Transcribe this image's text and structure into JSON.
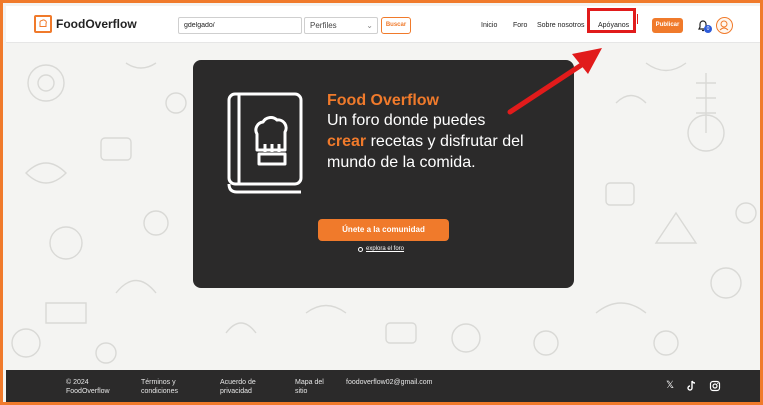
{
  "header": {
    "brand": "FoodOverflow",
    "search": {
      "value": "gdelgado/"
    },
    "filter": {
      "selected": "Perfiles"
    },
    "search_button": "Buscar",
    "nav": [
      "Inicio",
      "Foro",
      "Sobre nosotros",
      "Apóyanos"
    ],
    "publish_button": "Publicar",
    "notification_count": "0"
  },
  "hero": {
    "title": "Food Overflow",
    "line1": "Un foro donde puedes",
    "highlight": "crear",
    "line2": " recetas y disfrutar del mundo de la comida.",
    "join_button": "Únete a la comunidad",
    "explore_link": "explora el foro"
  },
  "footer": {
    "copyright_line1": "© 2024",
    "copyright_line2": "FoodOverflow",
    "terms_line1": "Términos y",
    "terms_line2": "condiciones",
    "privacy_line1": "Acuerdo de",
    "privacy_line2": "privacidad",
    "sitemap_line1": "Mapa del",
    "sitemap_line2": "sitio",
    "email": "foodoverflow02@gmail.com"
  },
  "colors": {
    "accent": "#f07a2b",
    "dark": "#2b2a2a",
    "annotation": "#e11b1b"
  },
  "icons": [
    "chef-book-icon",
    "bell-icon",
    "x-icon",
    "tiktok-icon",
    "instagram-icon",
    "chevron-down-icon"
  ]
}
